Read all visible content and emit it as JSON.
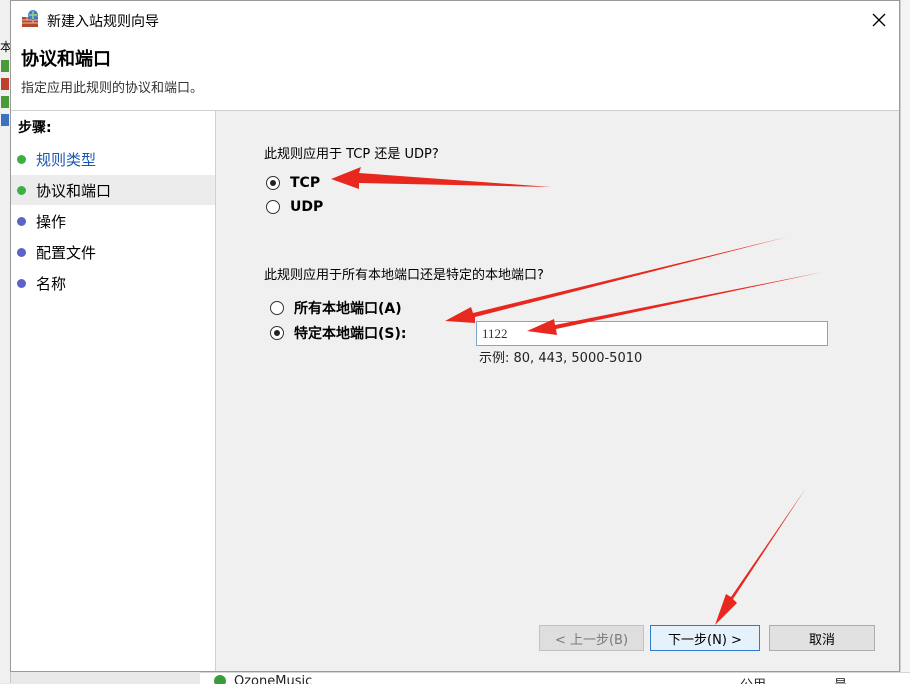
{
  "window": {
    "title": "新建入站规则向导",
    "icon": "firewall-icon",
    "close_icon": "close-icon"
  },
  "header": {
    "title": "协议和端口",
    "subtitle": "指定应用此规则的协议和端口。"
  },
  "steps": {
    "heading": "步骤:",
    "items": [
      {
        "label": "规则类型",
        "state": "done",
        "color": "#3cb043"
      },
      {
        "label": "协议和端口",
        "state": "current",
        "color": "#3cb043"
      },
      {
        "label": "操作",
        "state": "pending",
        "color": "#5a64c8"
      },
      {
        "label": "配置文件",
        "state": "pending",
        "color": "#5a64c8"
      },
      {
        "label": "名称",
        "state": "pending",
        "color": "#5a64c8"
      }
    ]
  },
  "protocol": {
    "question": "此规则应用于 TCP 还是 UDP?",
    "options": [
      {
        "label": "TCP",
        "selected": true
      },
      {
        "label": "UDP",
        "selected": false
      }
    ]
  },
  "ports": {
    "question": "此规则应用于所有本地端口还是特定的本地端口?",
    "options": [
      {
        "label": "所有本地端口(A)",
        "selected": false
      },
      {
        "label": "特定本地端口(S):",
        "selected": true
      }
    ],
    "value": "1122",
    "example": "示例: 80, 443, 5000-5010"
  },
  "buttons": {
    "back": "< 上一步(B)",
    "next": "下一步(N) >",
    "cancel": "取消"
  },
  "background": {
    "left_text": "本",
    "bottom_app": "QzoneMusic",
    "bottom_col1": "公用",
    "bottom_col2": "是"
  },
  "colors": {
    "annotation_arrow": "#e8281e",
    "focus_border": "#2f7bd1"
  }
}
